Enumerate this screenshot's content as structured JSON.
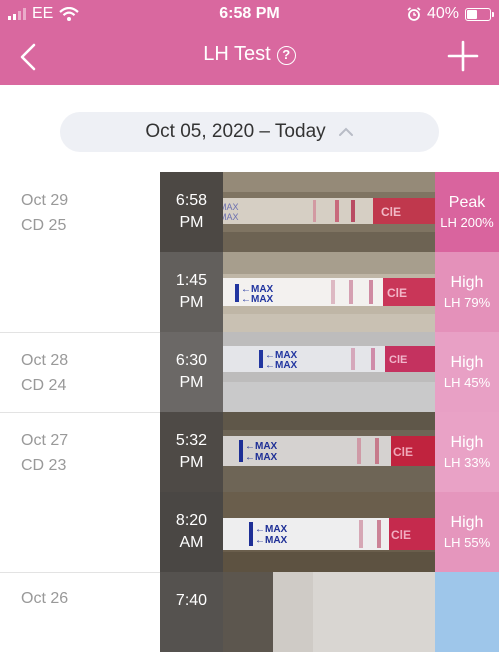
{
  "status_bar": {
    "carrier": "EE",
    "time": "6:58 PM",
    "battery": "40%",
    "battery_level": 0.4,
    "icons": [
      "signal-icon",
      "wifi-icon",
      "alarm-icon",
      "battery-icon"
    ]
  },
  "nav": {
    "title": "LH Test",
    "help_symbol": "?",
    "icons": [
      "back-chevron-icon",
      "help-icon",
      "add-icon"
    ]
  },
  "date_range": {
    "label": "Oct 05, 2020 – Today",
    "icon": "chevron-up-icon"
  },
  "colors": {
    "header_pink": "#d9689f",
    "peak_pink": "#d9649e",
    "high_pink": "#e79cc2",
    "low_blue": "#9ec6ea"
  },
  "days": [
    {
      "date": "Oct 29",
      "cd": "CD 25"
    },
    {
      "date": "Oct 28",
      "cd": "CD 24"
    },
    {
      "date": "Oct 27",
      "cd": "CD 23"
    },
    {
      "date": "Oct 26",
      "cd": ""
    }
  ],
  "tests": [
    {
      "time": "6:58",
      "ampm": "PM",
      "level": "Peak",
      "lh": "LH 200%"
    },
    {
      "time": "1:45",
      "ampm": "PM",
      "level": "High",
      "lh": "LH 79%"
    },
    {
      "time": "6:30",
      "ampm": "PM",
      "level": "High",
      "lh": "LH 45%"
    },
    {
      "time": "5:32",
      "ampm": "PM",
      "level": "High",
      "lh": "LH 33%"
    },
    {
      "time": "8:20",
      "ampm": "AM",
      "level": "High",
      "lh": "LH 55%"
    },
    {
      "time": "7:40",
      "ampm": "",
      "level": "",
      "lh": ""
    }
  ]
}
